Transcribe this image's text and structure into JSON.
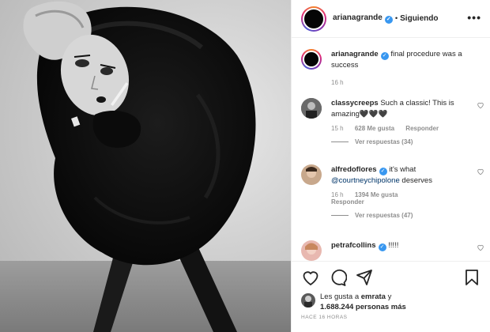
{
  "header": {
    "username": "arianagrande",
    "separator": "•",
    "follow_status": "Siguiendo",
    "more_icon": "more-horizontal-icon"
  },
  "caption": {
    "username": "arianagrande",
    "text": "final procedure was a success",
    "time": "16 h"
  },
  "comments": [
    {
      "username": "classycreeps",
      "text": "Such a classic! This is amazing🖤🖤🖤",
      "time": "15 h",
      "likes": "628 Me gusta",
      "reply": "Responder",
      "view_replies": "Ver respuestas (34)"
    },
    {
      "username": "alfredoflores",
      "text_before": "it's what",
      "mention": "@courtneychipolone",
      "text_after": "deserves",
      "time": "16 h",
      "likes": "1394 Me gusta",
      "reply": "Responder",
      "view_replies": "Ver respuestas (47)"
    },
    {
      "username": "petrafcollins",
      "text": "!!!!!"
    }
  ],
  "actions": {
    "icons": [
      "heart-icon",
      "comment-icon",
      "share-icon",
      "bookmark-icon"
    ]
  },
  "likes": {
    "prefix": "Les gusta a",
    "user": "emrata",
    "joiner": "y",
    "count": "1.688.244",
    "suffix": "personas más"
  },
  "timestamp": "HACE 16 HORAS",
  "colors": {
    "text": "#262626",
    "muted": "#8e8e8e",
    "verified": "#3897f0",
    "mention": "#003569"
  }
}
